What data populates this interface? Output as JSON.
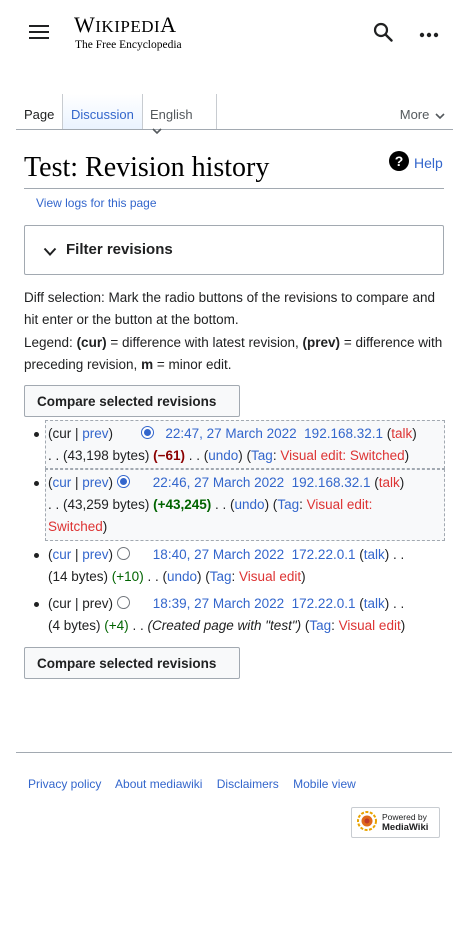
{
  "header": {
    "logo_word": "Wikipedia",
    "logo_tagline": "The Free Encyclopedia"
  },
  "tabs": {
    "page": "Page",
    "discussion": "Discussion",
    "language": "English",
    "more": "More"
  },
  "title": "Test: Revision history",
  "help": "Help",
  "view_logs": "View logs for this page",
  "filter_label": "Filter revisions",
  "diff_selection": "Diff selection: Mark the radio buttons of the revisions to compare and hit enter or the button at the bottom.",
  "legend": {
    "prefix": "Legend: ",
    "cur": "(cur)",
    "cur_text": " = difference with latest revision, ",
    "prev": "(prev)",
    "prev_text": " = difference with preceding revision, ",
    "m": "m",
    "m_text": " = minor edit."
  },
  "compare_button": "Compare selected revisions",
  "revisions": [
    {
      "cur": "cur",
      "prev": "prev",
      "date": "22:47, 27 March 2022",
      "user": "192.168.32.1",
      "talk": "talk",
      "bytes": "(43,198 bytes)",
      "diff": "(−61)",
      "undo": "undo",
      "tag_label": "Tag",
      "tag": "Visual edit: Switched"
    },
    {
      "cur": "cur",
      "prev": "prev",
      "date": "22:46, 27 March 2022",
      "user": "192.168.32.1",
      "talk": "talk",
      "bytes": "(43,259 bytes)",
      "diff": "(+43,245)",
      "undo": "undo",
      "tag_label": "Tag",
      "tag_part1": "Visual edit:",
      "tag_part2": "Switched"
    },
    {
      "cur": "cur",
      "prev": "prev",
      "date": "18:40, 27 March 2022",
      "user": "172.22.0.1",
      "talk": "talk",
      "bytes": "(14 bytes)",
      "diff": "(+10)",
      "undo": "undo",
      "tag_label": "Tag",
      "tag": "Visual edit"
    },
    {
      "cur": "cur",
      "prev": "prev",
      "date": "18:39, 27 March 2022",
      "user": "172.22.0.1",
      "talk": "talk",
      "bytes": "(4 bytes)",
      "diff": "(+4)",
      "comment": "(Created page with \"test\")",
      "tag_label": "Tag",
      "tag": "Visual edit"
    }
  ],
  "footer": {
    "privacy": "Privacy policy",
    "about": "About mediawiki",
    "disclaimers": "Disclaimers",
    "mobile": "Mobile view",
    "powered_line1": "Powered by",
    "powered_line2": "MediaWiki"
  },
  "colors": {
    "link": "#3366cc",
    "redlink": "#d33",
    "negative": "#8b0000",
    "positive": "#006400"
  }
}
